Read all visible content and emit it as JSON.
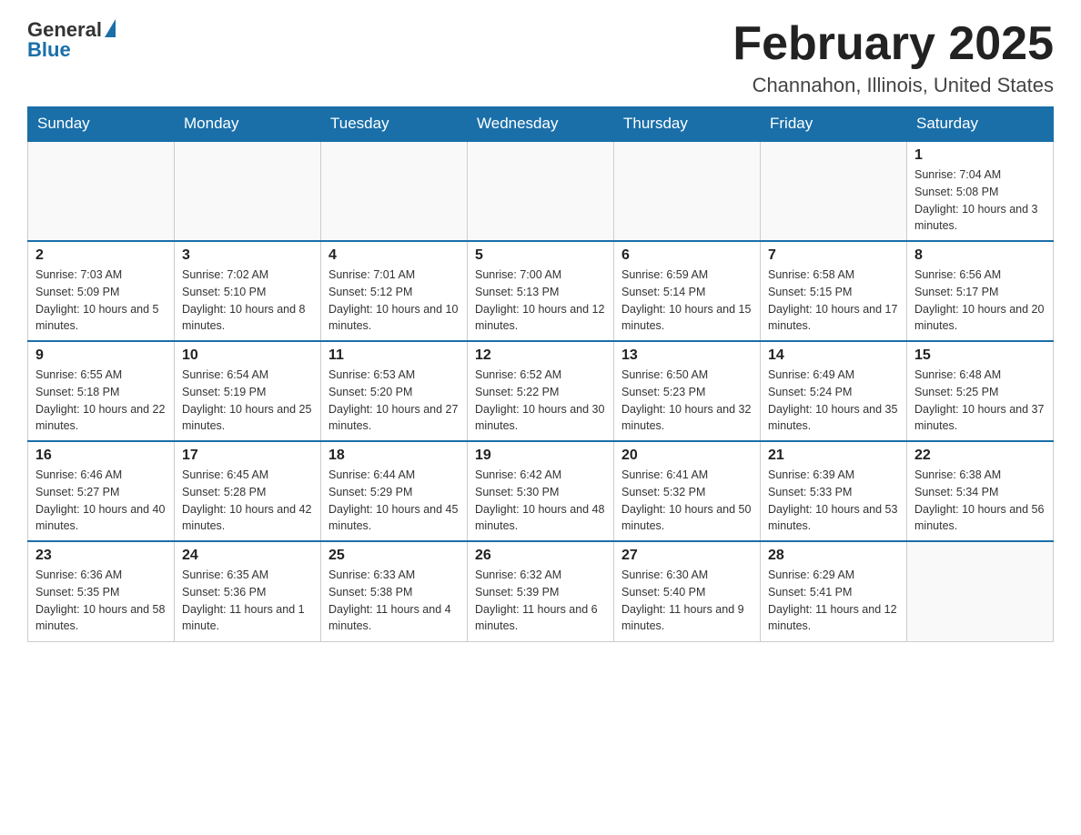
{
  "logo": {
    "general": "General",
    "blue": "Blue"
  },
  "header": {
    "title": "February 2025",
    "location": "Channahon, Illinois, United States"
  },
  "weekdays": [
    "Sunday",
    "Monday",
    "Tuesday",
    "Wednesday",
    "Thursday",
    "Friday",
    "Saturday"
  ],
  "weeks": [
    [
      {
        "day": "",
        "info": ""
      },
      {
        "day": "",
        "info": ""
      },
      {
        "day": "",
        "info": ""
      },
      {
        "day": "",
        "info": ""
      },
      {
        "day": "",
        "info": ""
      },
      {
        "day": "",
        "info": ""
      },
      {
        "day": "1",
        "info": "Sunrise: 7:04 AM\nSunset: 5:08 PM\nDaylight: 10 hours and 3 minutes."
      }
    ],
    [
      {
        "day": "2",
        "info": "Sunrise: 7:03 AM\nSunset: 5:09 PM\nDaylight: 10 hours and 5 minutes."
      },
      {
        "day": "3",
        "info": "Sunrise: 7:02 AM\nSunset: 5:10 PM\nDaylight: 10 hours and 8 minutes."
      },
      {
        "day": "4",
        "info": "Sunrise: 7:01 AM\nSunset: 5:12 PM\nDaylight: 10 hours and 10 minutes."
      },
      {
        "day": "5",
        "info": "Sunrise: 7:00 AM\nSunset: 5:13 PM\nDaylight: 10 hours and 12 minutes."
      },
      {
        "day": "6",
        "info": "Sunrise: 6:59 AM\nSunset: 5:14 PM\nDaylight: 10 hours and 15 minutes."
      },
      {
        "day": "7",
        "info": "Sunrise: 6:58 AM\nSunset: 5:15 PM\nDaylight: 10 hours and 17 minutes."
      },
      {
        "day": "8",
        "info": "Sunrise: 6:56 AM\nSunset: 5:17 PM\nDaylight: 10 hours and 20 minutes."
      }
    ],
    [
      {
        "day": "9",
        "info": "Sunrise: 6:55 AM\nSunset: 5:18 PM\nDaylight: 10 hours and 22 minutes."
      },
      {
        "day": "10",
        "info": "Sunrise: 6:54 AM\nSunset: 5:19 PM\nDaylight: 10 hours and 25 minutes."
      },
      {
        "day": "11",
        "info": "Sunrise: 6:53 AM\nSunset: 5:20 PM\nDaylight: 10 hours and 27 minutes."
      },
      {
        "day": "12",
        "info": "Sunrise: 6:52 AM\nSunset: 5:22 PM\nDaylight: 10 hours and 30 minutes."
      },
      {
        "day": "13",
        "info": "Sunrise: 6:50 AM\nSunset: 5:23 PM\nDaylight: 10 hours and 32 minutes."
      },
      {
        "day": "14",
        "info": "Sunrise: 6:49 AM\nSunset: 5:24 PM\nDaylight: 10 hours and 35 minutes."
      },
      {
        "day": "15",
        "info": "Sunrise: 6:48 AM\nSunset: 5:25 PM\nDaylight: 10 hours and 37 minutes."
      }
    ],
    [
      {
        "day": "16",
        "info": "Sunrise: 6:46 AM\nSunset: 5:27 PM\nDaylight: 10 hours and 40 minutes."
      },
      {
        "day": "17",
        "info": "Sunrise: 6:45 AM\nSunset: 5:28 PM\nDaylight: 10 hours and 42 minutes."
      },
      {
        "day": "18",
        "info": "Sunrise: 6:44 AM\nSunset: 5:29 PM\nDaylight: 10 hours and 45 minutes."
      },
      {
        "day": "19",
        "info": "Sunrise: 6:42 AM\nSunset: 5:30 PM\nDaylight: 10 hours and 48 minutes."
      },
      {
        "day": "20",
        "info": "Sunrise: 6:41 AM\nSunset: 5:32 PM\nDaylight: 10 hours and 50 minutes."
      },
      {
        "day": "21",
        "info": "Sunrise: 6:39 AM\nSunset: 5:33 PM\nDaylight: 10 hours and 53 minutes."
      },
      {
        "day": "22",
        "info": "Sunrise: 6:38 AM\nSunset: 5:34 PM\nDaylight: 10 hours and 56 minutes."
      }
    ],
    [
      {
        "day": "23",
        "info": "Sunrise: 6:36 AM\nSunset: 5:35 PM\nDaylight: 10 hours and 58 minutes."
      },
      {
        "day": "24",
        "info": "Sunrise: 6:35 AM\nSunset: 5:36 PM\nDaylight: 11 hours and 1 minute."
      },
      {
        "day": "25",
        "info": "Sunrise: 6:33 AM\nSunset: 5:38 PM\nDaylight: 11 hours and 4 minutes."
      },
      {
        "day": "26",
        "info": "Sunrise: 6:32 AM\nSunset: 5:39 PM\nDaylight: 11 hours and 6 minutes."
      },
      {
        "day": "27",
        "info": "Sunrise: 6:30 AM\nSunset: 5:40 PM\nDaylight: 11 hours and 9 minutes."
      },
      {
        "day": "28",
        "info": "Sunrise: 6:29 AM\nSunset: 5:41 PM\nDaylight: 11 hours and 12 minutes."
      },
      {
        "day": "",
        "info": ""
      }
    ]
  ]
}
